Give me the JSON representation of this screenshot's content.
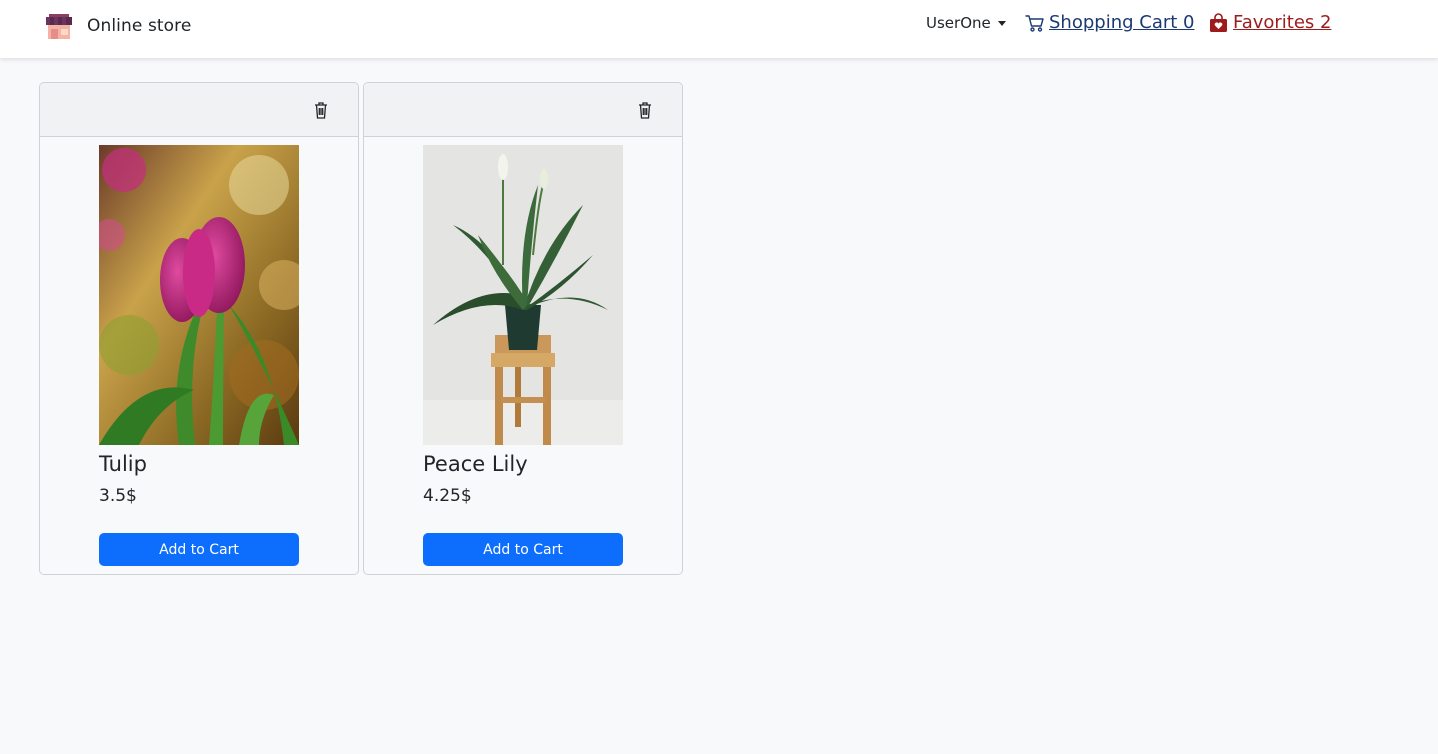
{
  "navbar": {
    "brand_text": "Online store",
    "brand_icon": "store-icon",
    "user_label": "UserOne",
    "cart_label": "Shopping Cart 0",
    "cart_icon": "cart-icon",
    "favorites_label": "Favorites 2",
    "favorites_icon": "bag-heart-icon"
  },
  "colors": {
    "primary_button": "#0d6efd",
    "cart_link": "#1b3a73",
    "favorites_link": "#9e1b1b",
    "page_background": "#f8f9fa"
  },
  "products": [
    {
      "name": "Tulip",
      "price": "3.5$",
      "button_label": "Add to Cart",
      "image": "tulip-photo",
      "delete_icon": "trash-icon"
    },
    {
      "name": "Peace Lily",
      "price": "4.25$",
      "button_label": "Add to Cart",
      "image": "peace-lily-photo",
      "delete_icon": "trash-icon"
    }
  ]
}
